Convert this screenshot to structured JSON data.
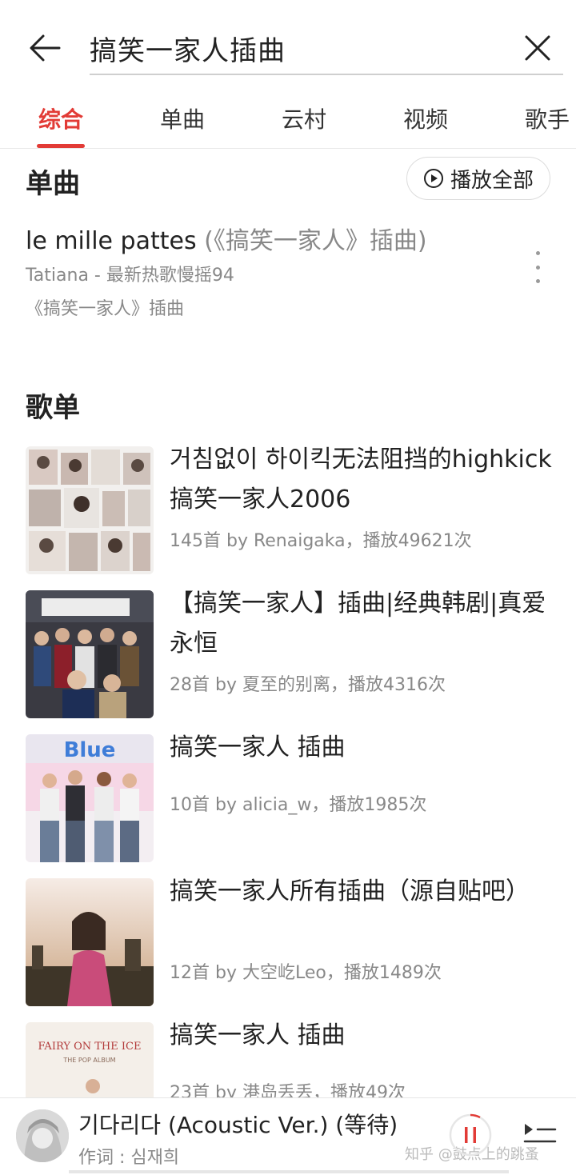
{
  "search": {
    "query": "搞笑一家人插曲"
  },
  "tabs": [
    {
      "label": "综合",
      "active": true
    },
    {
      "label": "单曲",
      "active": false
    },
    {
      "label": "云村",
      "active": false
    },
    {
      "label": "视频",
      "active": false
    },
    {
      "label": "歌手",
      "active": false
    }
  ],
  "songs_section": {
    "title": "单曲",
    "play_all_label": "播放全部",
    "songs": [
      {
        "name": "le mille pattes",
        "alias": " (《搞笑一家人》插曲)",
        "meta": "Tatiana - 最新热歌慢摇94",
        "sub": "《搞笑一家人》插曲"
      }
    ]
  },
  "playlists_section": {
    "title": "歌单",
    "playlists": [
      {
        "title": "거침없이 하이킥无法阻挡的highkick搞笑一家人2006",
        "meta": "145首  by Renaigaka，播放49621次"
      },
      {
        "title": "【搞笑一家人】插曲|经典韩剧|真爱永恒",
        "meta": "28首  by 夏至的别离，播放4316次"
      },
      {
        "title": "搞笑一家人 插曲",
        "meta": "10首  by alicia_w，播放1985次"
      },
      {
        "title": "搞笑一家人所有插曲（源自贴吧）",
        "meta": "12首  by 大空屹Leo，播放1489次"
      },
      {
        "title": "搞笑一家人 插曲",
        "meta": "23首  by 港岛丢丢，播放49次"
      }
    ]
  },
  "player": {
    "title": "기다리다 (Acoustic Ver.) (等待)",
    "subtitle": "作词 : 심재희"
  },
  "watermark": "知乎 @鼓点上的跳蚤",
  "colors": {
    "accent": "#e23b36",
    "text": "#222222",
    "secondary": "#888888"
  }
}
